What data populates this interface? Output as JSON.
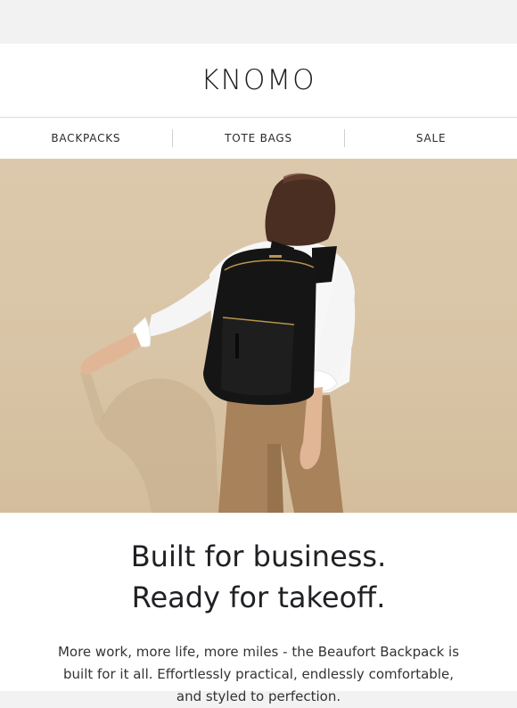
{
  "brand": {
    "logo": "KNOMO"
  },
  "nav": {
    "items": [
      {
        "label": "BACKPACKS"
      },
      {
        "label": "TOTE BAGS"
      },
      {
        "label": "SALE"
      }
    ]
  },
  "hero": {
    "image_description": ""
  },
  "content": {
    "headline_line1": "Built for business.",
    "headline_line2": "Ready for takeoff.",
    "body": "More work, more life, more miles - the Beaufort Backpack is built for it all. Effortlessly practical, endlessly comfortable, and styled to perfection."
  },
  "colors": {
    "background": "#f2f2f2",
    "header_bg": "#ffffff",
    "text": "#222222",
    "hero_wall": "#dcc9ac"
  }
}
